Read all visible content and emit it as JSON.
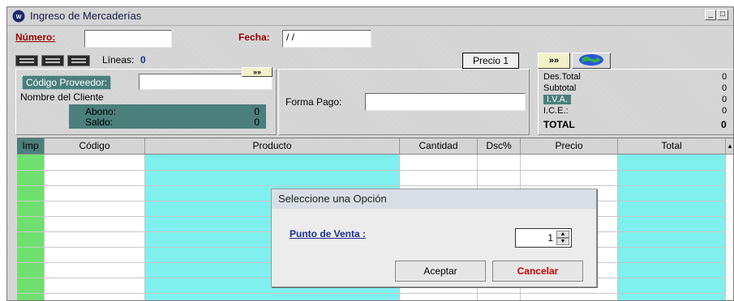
{
  "window": {
    "title": "Ingreso de Mercaderías",
    "controls": [
      "_",
      "□"
    ]
  },
  "header": {
    "numero_label": "Número:",
    "numero_value": "",
    "fecha_label": "Fecha:",
    "fecha_value": "/ /",
    "lineas_label": "Líneas:",
    "lineas_value": "0",
    "precio_label": "Precio 1",
    "nav_button": "»»"
  },
  "proveedor": {
    "codigo_label": "Código Proveedor:",
    "codigo_value": "",
    "nombre_label": "Nombre del Cliente",
    "abono_label": "Abono:",
    "abono_value": "0",
    "saldo_label": "Saldo:",
    "saldo_value": "0",
    "forma_pago_label": "Forma Pago:",
    "forma_pago_value": ""
  },
  "totals": {
    "rows": [
      {
        "label": "Des.Total",
        "value": "0"
      },
      {
        "label": "Subtotal",
        "value": "0"
      },
      {
        "label": "I.V.A.",
        "value": "0"
      },
      {
        "label": "I.C.E.:",
        "value": "0"
      },
      {
        "label": "TOTAL",
        "value": "0"
      }
    ]
  },
  "grid": {
    "columns": [
      "Imp",
      "Código",
      "Producto",
      "Cantidad",
      "Dsc%",
      "Precio",
      "Total"
    ]
  },
  "dialog": {
    "title": "Seleccione una Opción",
    "punto_label": "Punto de Venta :",
    "punto_value": "1",
    "accept_label": "Aceptar",
    "cancel_label": "Cancelar"
  },
  "colors": {
    "accent_teal": "#4b7f7b",
    "grid_cyan": "#7ff0ee",
    "grid_green": "#6fe06f",
    "label_red": "#990000"
  }
}
